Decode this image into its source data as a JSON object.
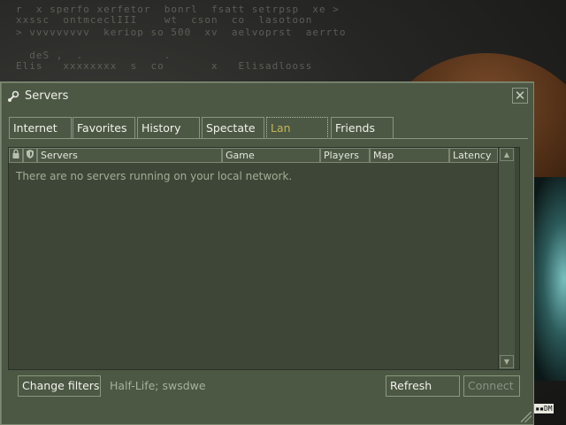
{
  "window": {
    "title": "Servers",
    "close_glyph": "✕"
  },
  "tabs": [
    {
      "label": "Internet",
      "active": false
    },
    {
      "label": "Favorites",
      "active": false
    },
    {
      "label": "History",
      "active": false
    },
    {
      "label": "Spectate",
      "active": false
    },
    {
      "label": "Lan",
      "active": true
    },
    {
      "label": "Friends",
      "active": false
    }
  ],
  "list": {
    "columns": [
      "Servers",
      "Game",
      "Players",
      "Map",
      "Latency"
    ],
    "icon_columns": [
      "lock-icon",
      "shield-icon"
    ],
    "empty_message": "There are no servers running on your local network."
  },
  "footer": {
    "change_filters_label": "Change filters",
    "filter_summary": "Half-Life; swsdwe",
    "refresh_label": "Refresh",
    "connect_label": "Connect"
  },
  "colors": {
    "window_bg": "#4c5844",
    "list_bg": "#3e4737",
    "active_tab_text": "#c4b55a"
  }
}
